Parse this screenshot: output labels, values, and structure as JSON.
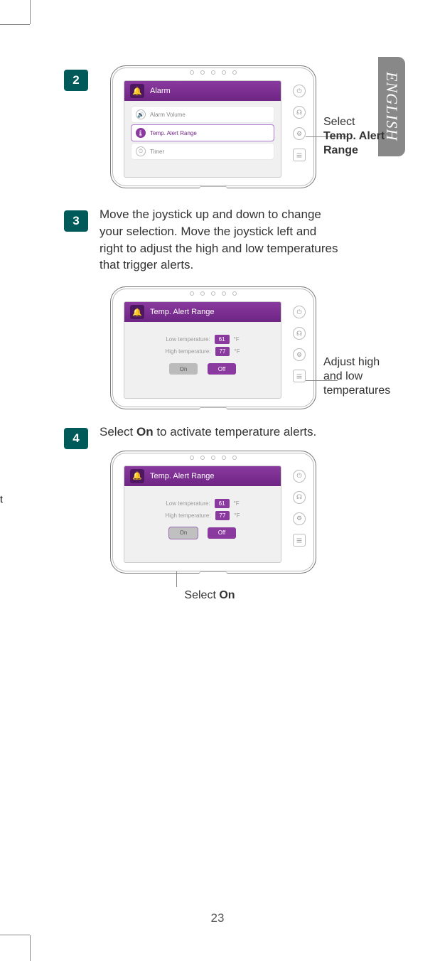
{
  "language_tab": "ENGLISH",
  "page_number": "23",
  "stray_mark": "t",
  "callouts": {
    "c1_prefix": "Select",
    "c1_bold": "Temp. Alert Range",
    "c2": "Adjust high and low temperatures",
    "c3_prefix": "Select ",
    "c3_bold": "On"
  },
  "steps": {
    "s2": {
      "num": "2"
    },
    "s3": {
      "num": "3",
      "text": "Move the joystick up and down to change your selection. Move the joystick left and right to adjust the high and low temperatures that trigger alerts."
    },
    "s4": {
      "num": "4",
      "text_before": "Select ",
      "text_bold": "On",
      "text_after": " to activate temperature alerts."
    }
  },
  "device1": {
    "title": "Alarm",
    "rows": {
      "volume": "Alarm Volume",
      "temp": "Temp. Alert Range",
      "timer": "Timer"
    }
  },
  "device2": {
    "title": "Temp. Alert Range",
    "low_label": "Low temperature:",
    "high_label": "High temperature:",
    "low_val": "61",
    "high_val": "77",
    "unit": "°F",
    "on": "On",
    "off": "Off"
  },
  "device3": {
    "title": "Temp. Alert Range",
    "low_label": "Low temperature:",
    "high_label": "High temperature:",
    "low_val": "61",
    "high_val": "77",
    "unit": "°F",
    "on": "On",
    "off": "Off"
  }
}
